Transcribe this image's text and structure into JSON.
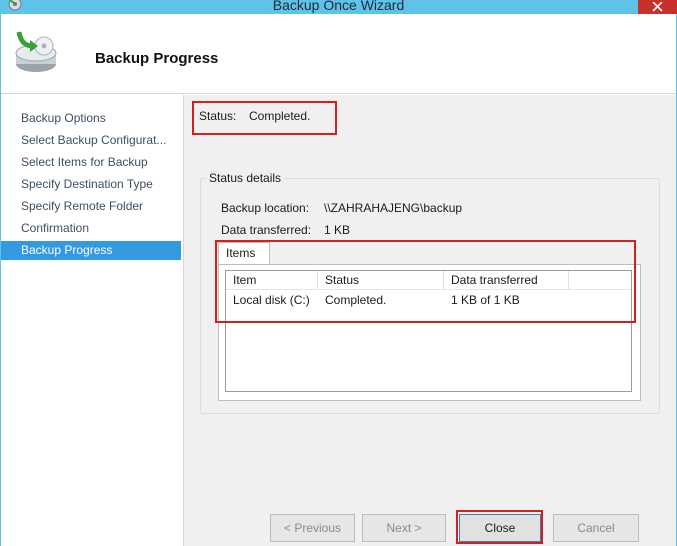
{
  "window": {
    "title": "Backup Once Wizard"
  },
  "header": {
    "title": "Backup Progress"
  },
  "nav": {
    "items": [
      {
        "label": "Backup Options"
      },
      {
        "label": "Select Backup Configurat..."
      },
      {
        "label": "Select Items for Backup"
      },
      {
        "label": "Specify Destination Type"
      },
      {
        "label": "Specify Remote Folder"
      },
      {
        "label": "Confirmation"
      },
      {
        "label": "Backup Progress"
      }
    ],
    "active_index": 6
  },
  "status": {
    "label": "Status:",
    "value": "Completed."
  },
  "details": {
    "group_label": "Status details",
    "backup_location_label": "Backup location:",
    "backup_location_value": "\\\\ZAHRAHAJENG\\backup",
    "data_transferred_label": "Data transferred:",
    "data_transferred_value": "1 KB"
  },
  "items_tab": {
    "label": "Items",
    "columns": [
      "Item",
      "Status",
      "Data transferred"
    ],
    "rows": [
      [
        "Local disk (C:)",
        "Completed.",
        "1 KB of 1 KB"
      ]
    ]
  },
  "buttons": {
    "previous": "< Previous",
    "next": "Next >",
    "close": "Close",
    "cancel": "Cancel"
  },
  "colors": {
    "titlebar": "#5fc3e8",
    "nav_active": "#3399e0",
    "highlight_box": "#d21f1f",
    "close_button": "#c7312b"
  },
  "icons": {
    "app": "backup-app-icon",
    "wizard": "backup-disk-icon",
    "close": "close-icon"
  }
}
